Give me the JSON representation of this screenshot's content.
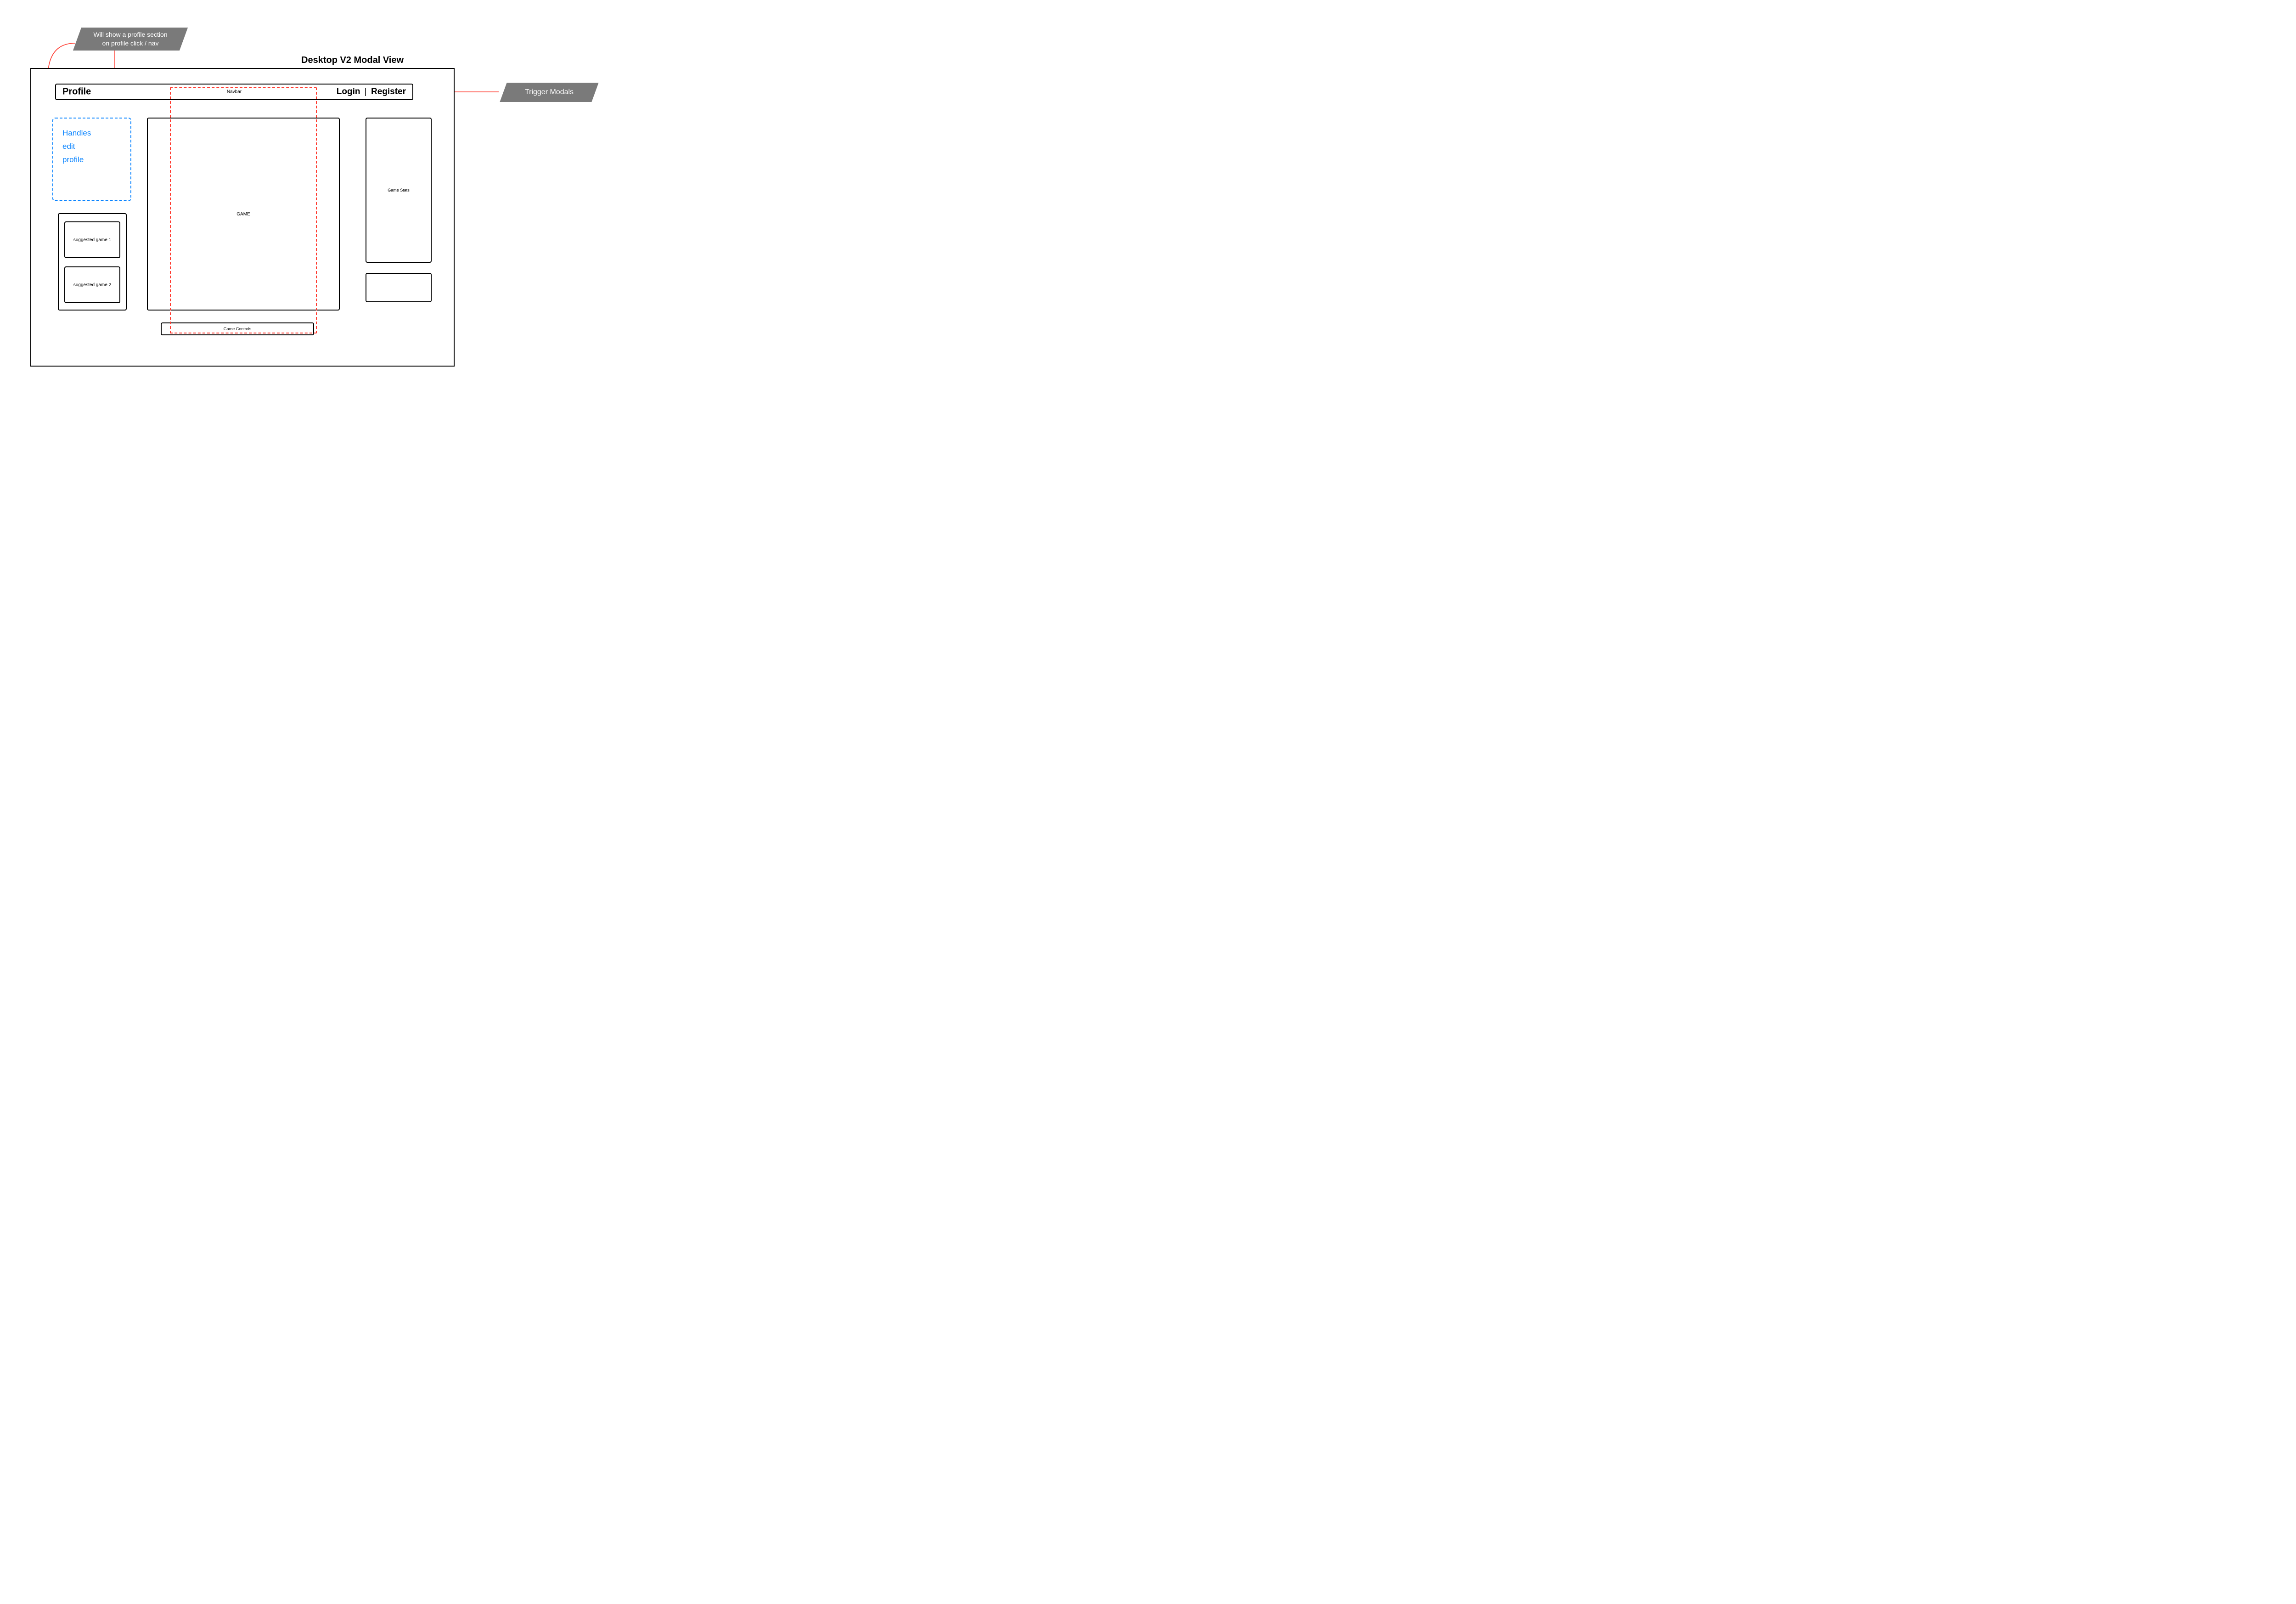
{
  "title": "Desktop V2 Modal View",
  "annotations": {
    "profile_note": "Will show a profile section\non profile click / nav",
    "trigger_modals": "Trigger Modals"
  },
  "navbar": {
    "label": "Navbar",
    "profile": "Profile",
    "login": "Login",
    "register": "Register",
    "separator": "|"
  },
  "profile_panel": {
    "line1": "Handles",
    "line2": "edit",
    "line3": "profile"
  },
  "suggested_games": {
    "item1": "suggested game 1",
    "item2": "suggested game 2"
  },
  "game_area": {
    "label": "GAME",
    "controls_label": "Game Controls"
  },
  "right_column": {
    "stats_label": "Game Stats"
  },
  "colors": {
    "annotation_bg": "#7a7a7a",
    "connector": "#ff3b30",
    "dashed_blue": "#0a84ff"
  }
}
